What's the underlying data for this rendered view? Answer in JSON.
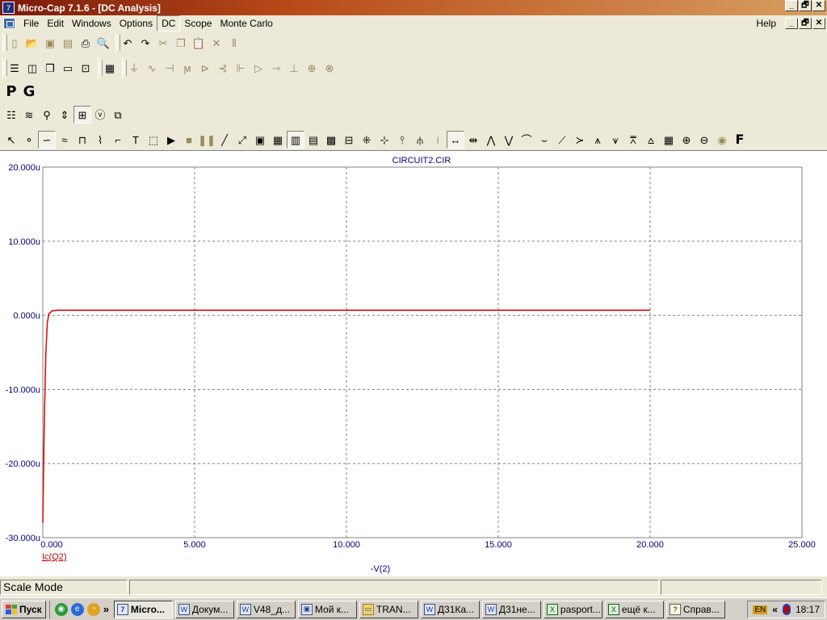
{
  "window": {
    "title": "Micro-Cap 7.1.6 - [DC Analysis]",
    "app_icon_label": "7",
    "btn_min": "_",
    "btn_max": "🗗",
    "btn_close": "✕"
  },
  "menu": {
    "items": [
      "File",
      "Edit",
      "Windows",
      "Options",
      "DC",
      "Scope",
      "Monte Carlo"
    ],
    "help": "Help"
  },
  "toolbar": {
    "big_letters": [
      "P",
      "G"
    ]
  },
  "plot": {
    "title": "CIRCUIT2.CIR",
    "y_ticks": [
      "20.000u",
      "10.000u",
      "0.000u",
      "-10.000u",
      "-20.000u",
      "-30.000u"
    ],
    "x_ticks": [
      "0.000",
      "5.000",
      "10.000",
      "15.000",
      "20.000",
      "25.000"
    ],
    "y_expression": "Ic(Q2)",
    "x_expression": "-V(2)",
    "colors": {
      "trace": "#e00000",
      "axis_text": "#000080",
      "grid": "#808080"
    }
  },
  "chart_data": {
    "type": "line",
    "title": "CIRCUIT2.CIR",
    "xlabel": "-V(2)",
    "ylabel": "Ic(Q2)",
    "xlim": [
      0,
      25
    ],
    "ylim": [
      -30,
      20
    ],
    "y_unit": "u",
    "grid": true,
    "series": [
      {
        "name": "Ic(Q2)",
        "x": [
          0,
          0.02,
          0.05,
          0.1,
          0.15,
          0.2,
          0.3,
          0.5,
          20
        ],
        "y": [
          -28,
          -22,
          -14,
          -5,
          -1,
          0.2,
          0.6,
          0.7,
          0.7
        ]
      }
    ]
  },
  "status": {
    "mode": "Scale Mode"
  },
  "taskbar": {
    "start": "Пуск",
    "quick_more": "»",
    "tasks": [
      "Micro...",
      "Докум...",
      "V48_д...",
      "Мой к...",
      "TRAN...",
      "Д31Ка...",
      "Д31не...",
      "pasport...",
      "ещё к...",
      "Справ..."
    ],
    "tray_lang": "EN",
    "tray_arrows": "«",
    "clock": "18:17"
  }
}
